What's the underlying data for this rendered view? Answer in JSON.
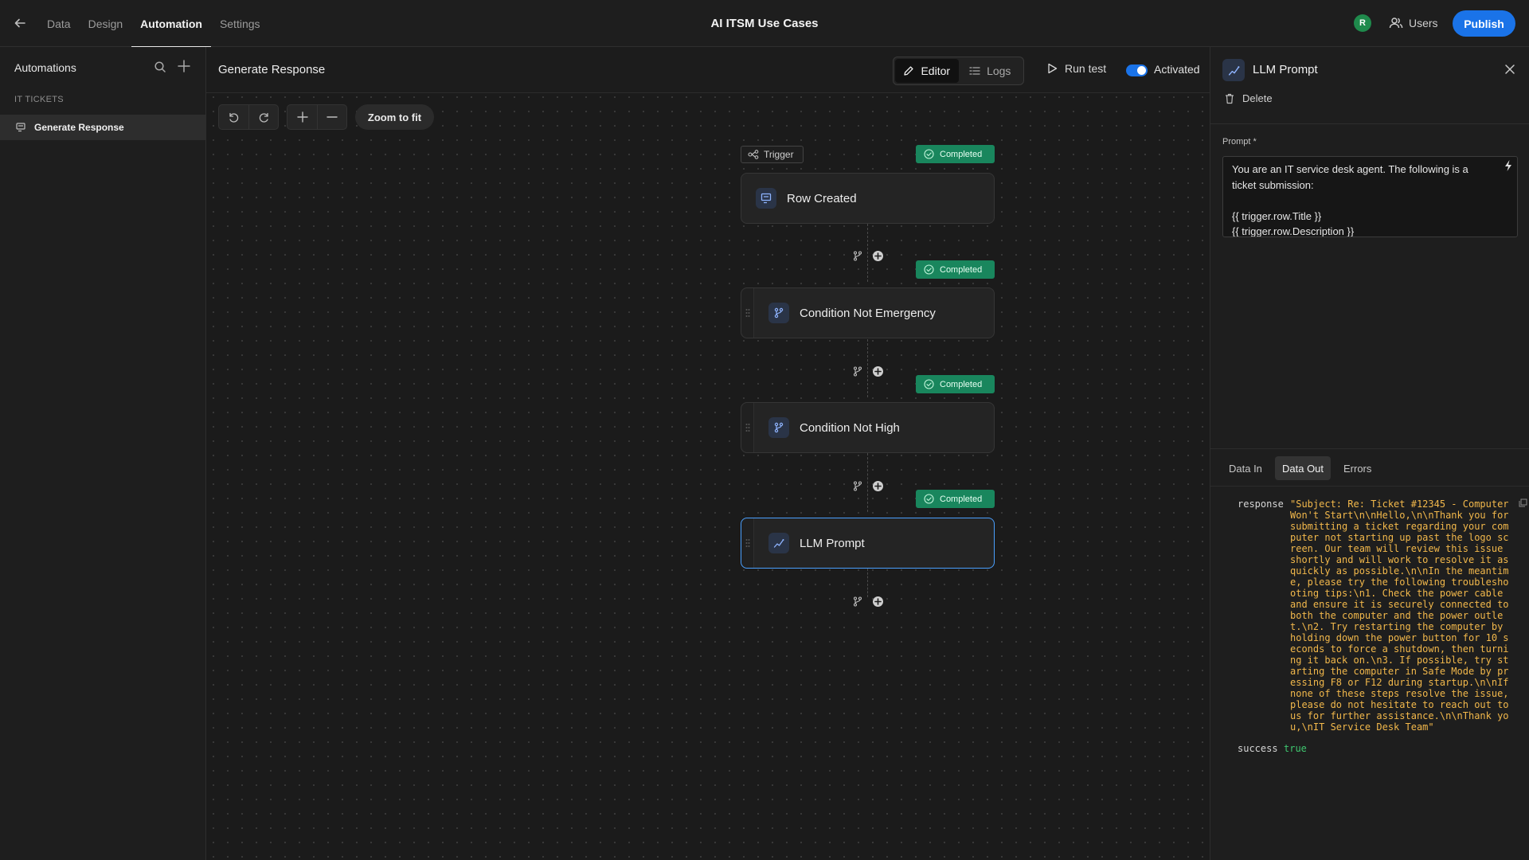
{
  "topbar": {
    "nav": [
      "Data",
      "Design",
      "Automation",
      "Settings"
    ],
    "active_tab": "Automation",
    "app_title": "AI ITSM Use Cases",
    "avatar_initial": "R",
    "users_label": "Users",
    "publish_label": "Publish"
  },
  "sidebar": {
    "title": "Automations",
    "section": "IT TICKETS",
    "items": [
      {
        "label": "Generate Response",
        "active": true
      }
    ]
  },
  "canvas": {
    "title": "Generate Response",
    "modes": {
      "editor": "Editor",
      "logs": "Logs"
    },
    "active_mode": "Editor",
    "run_test_label": "Run test",
    "activated_label": "Activated",
    "activated": true,
    "zoom_fit_label": "Zoom to fit",
    "trigger_tag": "Trigger",
    "steps": [
      {
        "label": "Row Created",
        "status": "Completed",
        "icon": "table-row-icon"
      },
      {
        "label": "Condition Not Emergency",
        "status": "Completed",
        "icon": "branch-icon"
      },
      {
        "label": "Condition Not High",
        "status": "Completed",
        "icon": "branch-icon"
      },
      {
        "label": "LLM Prompt",
        "status": "Completed",
        "icon": "sparkline-icon",
        "selected": true
      }
    ]
  },
  "panel": {
    "title": "LLM Prompt",
    "delete_label": "Delete",
    "prompt_label": "Prompt *",
    "prompt_text": "You are an IT service desk agent. The following is a ticket submission:\n\n{{ trigger.row.Title }}\n{{ trigger.row.Description }}",
    "tabs": [
      "Data In",
      "Data Out",
      "Errors"
    ],
    "active_tab": "Data Out",
    "output": {
      "response_key": "response",
      "response_value": "\"Subject: Re: Ticket #12345 - Computer Won't Start\\n\\nHello,\\n\\nThank you for submitting a ticket regarding your computer not starting up past the logo screen. Our team will review this issue shortly and will work to resolve it as quickly as possible.\\n\\nIn the meantime, please try the following troubleshooting tips:\\n1. Check the power cable and ensure it is securely connected to both the computer and the power outlet.\\n2. Try restarting the computer by holding down the power button for 10 seconds to force a shutdown, then turning it back on.\\n3. If possible, try starting the computer in Safe Mode by pressing F8 or F12 during startup.\\n\\nIf none of these steps resolve the issue, please do not hesitate to reach out to us for further assistance.\\n\\nThank you,\\nIT Service Desk Team\"",
      "success_key": "success",
      "success_value": "true"
    }
  },
  "colors": {
    "accent": "#1a73e8",
    "completed": "#19865d",
    "response_string": "#f2b84b",
    "boolean": "#3fc66f"
  }
}
